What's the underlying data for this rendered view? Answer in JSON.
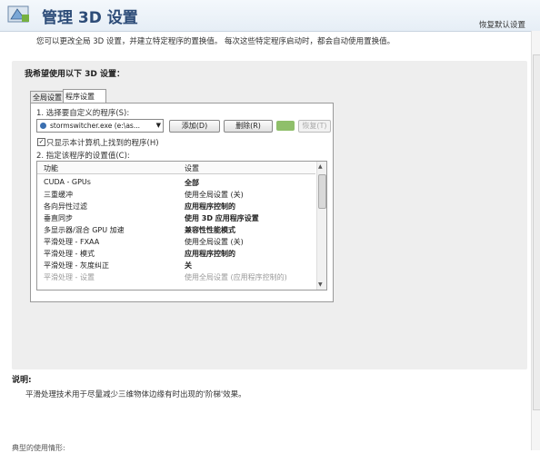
{
  "header": {
    "title": "管理 3D 设置",
    "restore_defaults": "恢复默认设置"
  },
  "intro": "您可以更改全局 3D 设置，并建立特定程序的置换值。 每次这些特定程序启动时，都会自动使用置换值。",
  "settings_prompt": "我希望使用以下 3D 设置：",
  "tabs": [
    {
      "label": "全局设置",
      "selected": false
    },
    {
      "label": "程序设置",
      "selected": true
    }
  ],
  "program_settings": {
    "step1_label": "1. 选择要自定义的程序(S):",
    "selected_program": "stormswitcher.exe (e:\\as...",
    "add_button": "添加(D)",
    "delete_button": "删除(R)",
    "restore_button": "恢复(T)",
    "only_show_checkbox": "只显示本计算机上找到的程序(H)",
    "only_show_checked": true,
    "step2_label": "2. 指定该程序的设置值(C):"
  },
  "settings_list": {
    "columns": [
      "功能",
      "设置"
    ],
    "rows": [
      {
        "feature": "CUDA - GPUs",
        "setting": "全部",
        "bold": true
      },
      {
        "feature": "三重缓冲",
        "setting": "使用全局设置 (关)",
        "bold": false
      },
      {
        "feature": "各向异性过滤",
        "setting": "应用程序控制的",
        "bold": true
      },
      {
        "feature": "垂直同步",
        "setting": "使用 3D 应用程序设置",
        "bold": true
      },
      {
        "feature": "多显示器/混合 GPU 加速",
        "setting": "兼容性性能模式",
        "bold": true
      },
      {
        "feature": "平滑处理 - FXAA",
        "setting": "使用全局设置 (关)",
        "bold": false
      },
      {
        "feature": "平滑处理 - 模式",
        "setting": "应用程序控制的",
        "bold": true
      },
      {
        "feature": "平滑处理 - 灰度纠正",
        "setting": "关",
        "bold": true
      },
      {
        "feature": "平滑处理 - 设置",
        "setting": "使用全局设置 (应用程序控制的)",
        "bold": false,
        "dim": true
      }
    ]
  },
  "description": {
    "title": "说明:",
    "text": "平滑处理技术用于尽量减少三维物体边缘有时出现的'阶梯'效果。"
  },
  "footer": "典型的使用情形:",
  "colors": {
    "title": "#2d4c78",
    "panel": "#eeeeee",
    "nvidia_green": "#8fbf6a"
  }
}
